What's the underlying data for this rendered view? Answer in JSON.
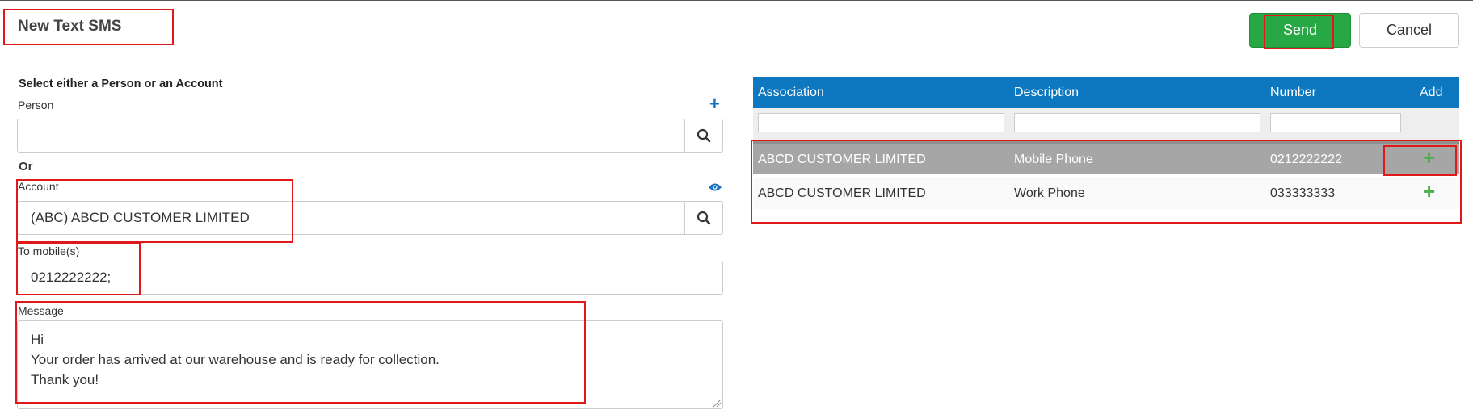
{
  "header": {
    "title": "New Text SMS",
    "send_label": "Send",
    "cancel_label": "Cancel"
  },
  "form": {
    "instruction": "Select either a Person or an Account",
    "person_label": "Person",
    "person_value": "",
    "or_label": "Or",
    "account_label": "Account",
    "account_value": "(ABC) ABCD CUSTOMER LIMITED",
    "to_mobile_label": "To mobile(s)",
    "to_mobile_value": "0212222222;",
    "message_label": "Message",
    "message_value": "Hi\nYour order has arrived at our warehouse and is ready for collection.\nThank you!"
  },
  "grid": {
    "columns": [
      "Association",
      "Description",
      "Number",
      "Add"
    ],
    "rows": [
      {
        "association": "ABCD CUSTOMER LIMITED",
        "description": "Mobile Phone",
        "number": "0212222222",
        "selected": true
      },
      {
        "association": "ABCD CUSTOMER LIMITED",
        "description": "Work Phone",
        "number": "033333333",
        "selected": false
      }
    ]
  },
  "colors": {
    "send": "#28a745",
    "grid_header": "#0d77bf",
    "selected_row": "#a6a6a6",
    "add_icon": "#4cae4c",
    "highlight": "#e01818"
  },
  "icons": {
    "person_add": "plus-icon",
    "account_view": "eye-icon",
    "search": "search-icon",
    "row_add": "plus-icon"
  }
}
